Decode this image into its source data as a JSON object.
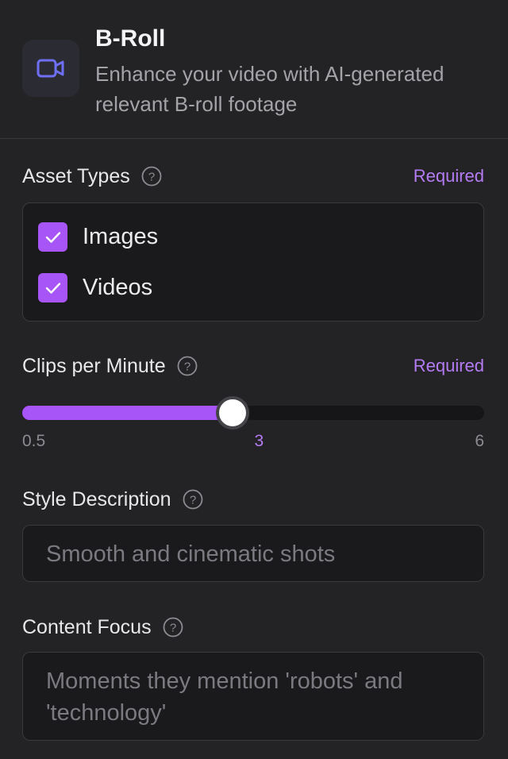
{
  "header": {
    "title": "B-Roll",
    "subtitle": "Enhance your video with AI-generated relevant B-roll footage",
    "icon": "video-camera-icon"
  },
  "asset_types": {
    "label": "Asset Types",
    "required": "Required",
    "options": [
      {
        "label": "Images",
        "checked": true
      },
      {
        "label": "Videos",
        "checked": true
      }
    ]
  },
  "clips_per_minute": {
    "label": "Clips per Minute",
    "required": "Required",
    "min_label": "0.5",
    "current_label": "3",
    "max_label": "6",
    "min": 0.5,
    "max": 6,
    "value": 3
  },
  "style_description": {
    "label": "Style Description",
    "placeholder": "Smooth and cinematic shots"
  },
  "content_focus": {
    "label": "Content Focus",
    "placeholder": "Moments they mention 'robots' and 'technology'"
  },
  "colors": {
    "accent": "#a855f7",
    "required_text": "#b57cf5",
    "background": "#232325",
    "field_background": "#1a1a1c"
  }
}
